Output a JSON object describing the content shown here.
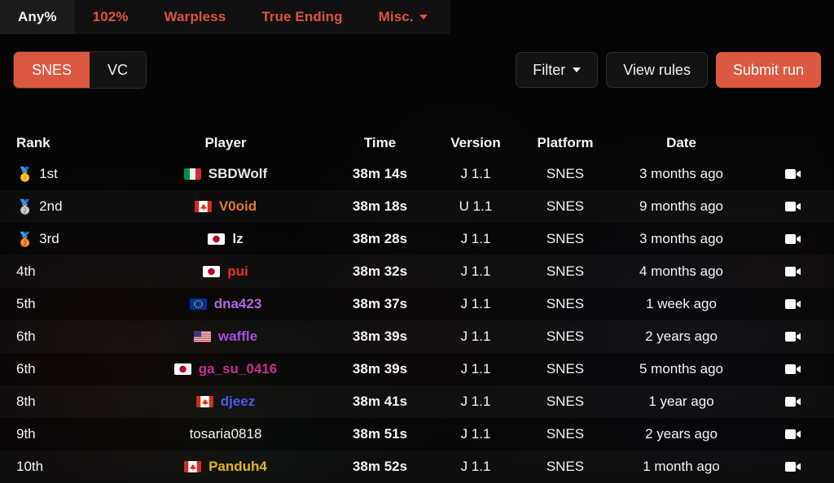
{
  "tabs": [
    {
      "label": "Any%",
      "active": true,
      "dropdown": false,
      "name": "tab-any-percent"
    },
    {
      "label": "102%",
      "active": false,
      "dropdown": false,
      "name": "tab-102-percent"
    },
    {
      "label": "Warpless",
      "active": false,
      "dropdown": false,
      "name": "tab-warpless"
    },
    {
      "label": "True Ending",
      "active": false,
      "dropdown": false,
      "name": "tab-true-ending"
    },
    {
      "label": "Misc.",
      "active": false,
      "dropdown": true,
      "name": "tab-misc"
    }
  ],
  "controls": {
    "segmented": [
      {
        "label": "SNES",
        "active": true
      },
      {
        "label": "VC",
        "active": false
      }
    ],
    "filter_label": "Filter",
    "view_rules_label": "View rules",
    "submit_run_label": "Submit run"
  },
  "table": {
    "headers": [
      "Rank",
      "Player",
      "Time",
      "Version",
      "Platform",
      "Date"
    ],
    "rows": [
      {
        "rank": "1st",
        "medal": "gold",
        "flag": "it",
        "player": "SBDWolf",
        "color": "#e8e8e8",
        "time_min": "38m",
        "time_sec": "14s",
        "version": "J 1.1",
        "platform": "SNES",
        "date": "3 months ago"
      },
      {
        "rank": "2nd",
        "medal": "silver",
        "flag": "ca",
        "player": "V0oid",
        "color": "#e8772c",
        "time_min": "38m",
        "time_sec": "18s",
        "version": "U 1.1",
        "platform": "SNES",
        "date": "9 months ago"
      },
      {
        "rank": "3rd",
        "medal": "bronze",
        "flag": "jp",
        "player": "lz",
        "color": "#e8e8e8",
        "time_min": "38m",
        "time_sec": "28s",
        "version": "J 1.1",
        "platform": "SNES",
        "date": "3 months ago"
      },
      {
        "rank": "4th",
        "medal": "",
        "flag": "jp",
        "player": "pui",
        "color": "#e8312f",
        "time_min": "38m",
        "time_sec": "32s",
        "version": "J 1.1",
        "platform": "SNES",
        "date": "4 months ago"
      },
      {
        "rank": "5th",
        "medal": "",
        "flag": "eu",
        "player": "dna423",
        "color": "#b06ae0",
        "time_min": "38m",
        "time_sec": "37s",
        "version": "J 1.1",
        "platform": "SNES",
        "date": "1 week ago"
      },
      {
        "rank": "6th",
        "medal": "",
        "flag": "us",
        "player": "waffle",
        "color": "#a74fe0",
        "time_min": "38m",
        "time_sec": "39s",
        "version": "J 1.1",
        "platform": "SNES",
        "date": "2 years ago"
      },
      {
        "rank": "6th",
        "medal": "",
        "flag": "jp",
        "player": "ga_su_0416",
        "color": "#c22f94",
        "time_min": "38m",
        "time_sec": "39s",
        "version": "J 1.1",
        "platform": "SNES",
        "date": "5 months ago"
      },
      {
        "rank": "8th",
        "medal": "",
        "flag": "ca",
        "player": "djeez",
        "color": "#4a5be8",
        "time_min": "38m",
        "time_sec": "41s",
        "version": "J 1.1",
        "platform": "SNES",
        "date": "1 year ago"
      },
      {
        "rank": "9th",
        "medal": "",
        "flag": "",
        "player": "tosaria0818",
        "color": "#f5f5f5",
        "time_min": "38m",
        "time_sec": "51s",
        "version": "J 1.1",
        "platform": "SNES",
        "date": "2 years ago"
      },
      {
        "rank": "10th",
        "medal": "",
        "flag": "ca",
        "player": "Panduh4",
        "color": "#e8b518",
        "time_min": "38m",
        "time_sec": "52s",
        "version": "J 1.1",
        "platform": "SNES",
        "date": "1 month ago"
      }
    ],
    "video_icon": "video-camera-icon"
  },
  "colors": {
    "accent": "#dd5840",
    "tab_active_text": "#f2f2f2",
    "background": "#050505",
    "tabbar": "#111111"
  }
}
